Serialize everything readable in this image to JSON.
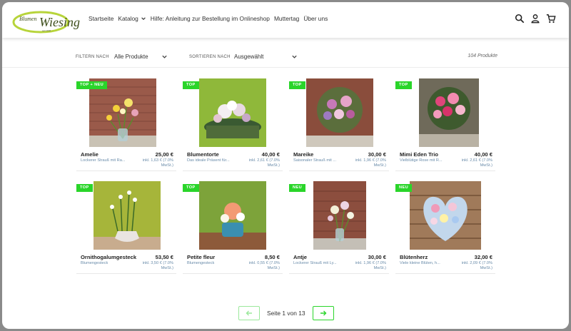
{
  "header": {
    "logo_text": "Blumen Wiesing",
    "nav": [
      "Startseite",
      "Katalog",
      "Hilfe: Anleitung zur Bestellung im Onlineshop",
      "Muttertag",
      "Über uns"
    ],
    "icons": [
      "search-icon",
      "account-icon",
      "cart-icon"
    ]
  },
  "filterbar": {
    "filter_label": "FILTERN NACH",
    "filter_value": "Alle Produkte",
    "sort_label": "SORTIEREN NACH",
    "sort_value": "Ausgewählt",
    "count": "104 Produkte"
  },
  "products": [
    {
      "badge": "TOP + NEU",
      "name": "Amelie",
      "price": "25,00 €",
      "desc": "Lockerer Strauß mit Ra...",
      "tax": "inkl. 1,63 € (7.0% MwSt.)"
    },
    {
      "badge": "TOP",
      "name": "Blumentorte",
      "price": "40,00 €",
      "desc": "Das ideale Präsent für...",
      "tax": "inkl. 2,61 € (7.0% MwSt.)"
    },
    {
      "badge": "TOP",
      "name": "Mareike",
      "price": "30,00 €",
      "desc": "Saisonaler Strauß mit ...",
      "tax": "inkl. 1,96 € (7.0% MwSt.)"
    },
    {
      "badge": "TOP",
      "name": "Mimi Eden Trio",
      "price": "40,00 €",
      "desc": "Vielblütige Rose mit R...",
      "tax": "inkl. 2,61 € (7.0% MwSt.)"
    },
    {
      "badge": "TOP",
      "name": "Ornithogalumgesteck",
      "price": "53,50 €",
      "desc": "Blumengesteck",
      "tax": "inkl. 3,50 € (7.0% MwSt.)"
    },
    {
      "badge": "TOP",
      "name": "Petite fleur",
      "price": "8,50 €",
      "desc": "Blumengesteck",
      "tax": "inkl. 0,55 € (7.0% MwSt.)"
    },
    {
      "badge": "NEU",
      "name": "Antje",
      "price": "30,00 €",
      "desc": "Lockerer Strauß mit Ly...",
      "tax": "inkl. 1,96 € (7.0% MwSt.)"
    },
    {
      "badge": "NEU",
      "name": "Blütenherz",
      "price": "32,00 €",
      "desc": "Viele kleine Blüten, h...",
      "tax": "inkl. 2,09 € (7.0% MwSt.)"
    }
  ],
  "pagination": {
    "text": "Seite 1 von 13"
  },
  "colors": {
    "accent": "#2ad52a",
    "logo_green": "#9bbf1f",
    "link_blue": "#6a8caa"
  }
}
